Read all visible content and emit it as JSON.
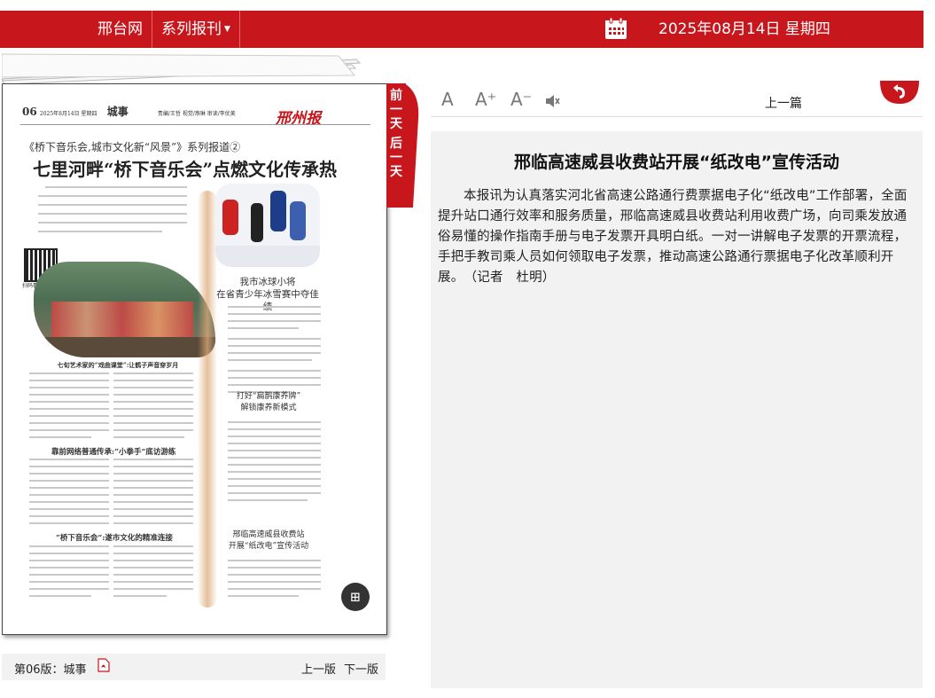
{
  "header": {
    "site_link": "邢台网",
    "series_menu": "系列报刊",
    "date": "2025年08月14日 星期四",
    "calendar_icon": "calendar-icon"
  },
  "side_tab": {
    "prev_day": "前一天",
    "next_day": "后一天"
  },
  "newspaper": {
    "page_number": "06",
    "page_meta": "2025年8月14日 星期四",
    "section": "城事",
    "editors": "责编/王哲  视觉/燕琳  审读/李优美",
    "brand": "邢州报",
    "kicker": "《桥下音乐会,城市文化新“风景”》系列报道②",
    "headline": "七里河畔“桥下音乐会”点燃文化传承热",
    "qr_caption": "扫码看视频",
    "photo_caption": "七旬艺术家的“戏曲课堂”:让鹤子声音穿岁月",
    "side_story_title_1": "我市冰球小将",
    "side_story_title_2": "在省青少年冰雪赛中夺佳绩",
    "sub_head_1": "靠前网络普通传承:“小拳手”底访游练",
    "sub_head_2": "“桥下音乐会”:遂市文化的精准连接",
    "side_story_2_title_1": "打好“扁鹊康养牌”",
    "side_story_2_title_2": "解锁康养新模式",
    "side_story_3_title_1": "邢临高速威县收费站",
    "side_story_3_title_2": "开展“纸改电”宣传活动"
  },
  "footer": {
    "edition_label": "第06版：城事",
    "pdf_icon": "pdf-icon",
    "prev_edition": "上一版",
    "next_edition": "下一版"
  },
  "toolbar": {
    "font_normal": "A",
    "font_larger": "A⁺",
    "font_smaller": "A⁻",
    "speaker_icon": "speaker-icon",
    "prev_article": "上一篇",
    "back_icon": "back-arrow-icon"
  },
  "article": {
    "title": "邢临高速威县收费站开展“纸改电”宣传活动",
    "body": "本报讯为认真落实河北省高速公路通行费票据电子化“纸改电”工作部署，全面提升站口通行效率和服务质量，邢临高速威县收费站利用收费广场，向司乘发放通俗易懂的操作指南手册与电子发票开具明白纸。一对一讲解电子发票的开票流程，手把手教司乘人员如何领取电子发票，推动高速公路通行票据电子化改革顺利开展。　（记者　杜明）"
  }
}
